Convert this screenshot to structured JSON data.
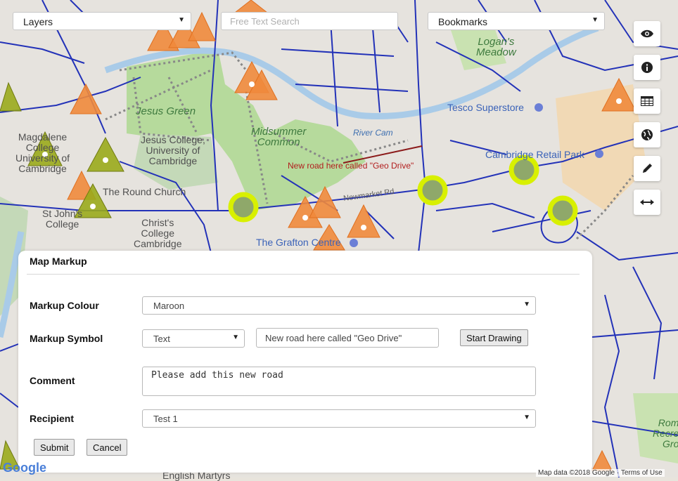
{
  "toolbar": {
    "layers_label": "Layers",
    "search_placeholder": "Free Text Search",
    "bookmarks_label": "Bookmarks"
  },
  "tools": [
    "eye-icon",
    "info-icon",
    "table-icon",
    "globe-icon",
    "pencil-icon",
    "measure-icon"
  ],
  "map_labels": {
    "jesus_green": "Jesus Green",
    "midsummer": "Midsummer\nCommon",
    "logans": "Logan's\nMeadow",
    "tesco": "Tesco Superstore",
    "retail": "Cambridge Retail Park",
    "jesus_college": "Jesus College,\nUniversity of\nCambridge",
    "round_church": "The Round Church",
    "christs": "Christ's\nCollege\nCambridge",
    "grafton": "The Grafton Centre",
    "river_cam": "River Cam",
    "newmarket": "Newmarket Rd",
    "annotation": "New road here called \"Geo Drive\"",
    "magdalene": "Magdalene\nCollege\nUniversity of\nCambridge",
    "st_johns": "St John's\nCollege",
    "english_martyrs": "English Martyrs",
    "rome_rec": "Rom\nRecre\nGro"
  },
  "panel": {
    "title": "Map Markup",
    "colour_label": "Markup Colour",
    "colour_value": "Maroon",
    "symbol_label": "Markup Symbol",
    "symbol_value": "Text",
    "text_value": "New road here called \"Geo Drive\"",
    "start_drawing": "Start Drawing",
    "comment_label": "Comment",
    "comment_value": "Please add this new road",
    "recipient_label": "Recipient",
    "recipient_value": "Test 1",
    "submit": "Submit",
    "cancel": "Cancel"
  },
  "footer": {
    "attribution": "Map data ©2018 Google · Terms of Use",
    "logo": "Google"
  },
  "colors": {
    "road": "#2332b8",
    "park": "#b9dca0",
    "water": "#a9cbe8",
    "marker_orange": "#f08a3c",
    "marker_olive": "#9aaa1c",
    "marker_circle": "#d8f000",
    "markup_line": "#8b1a1a"
  }
}
